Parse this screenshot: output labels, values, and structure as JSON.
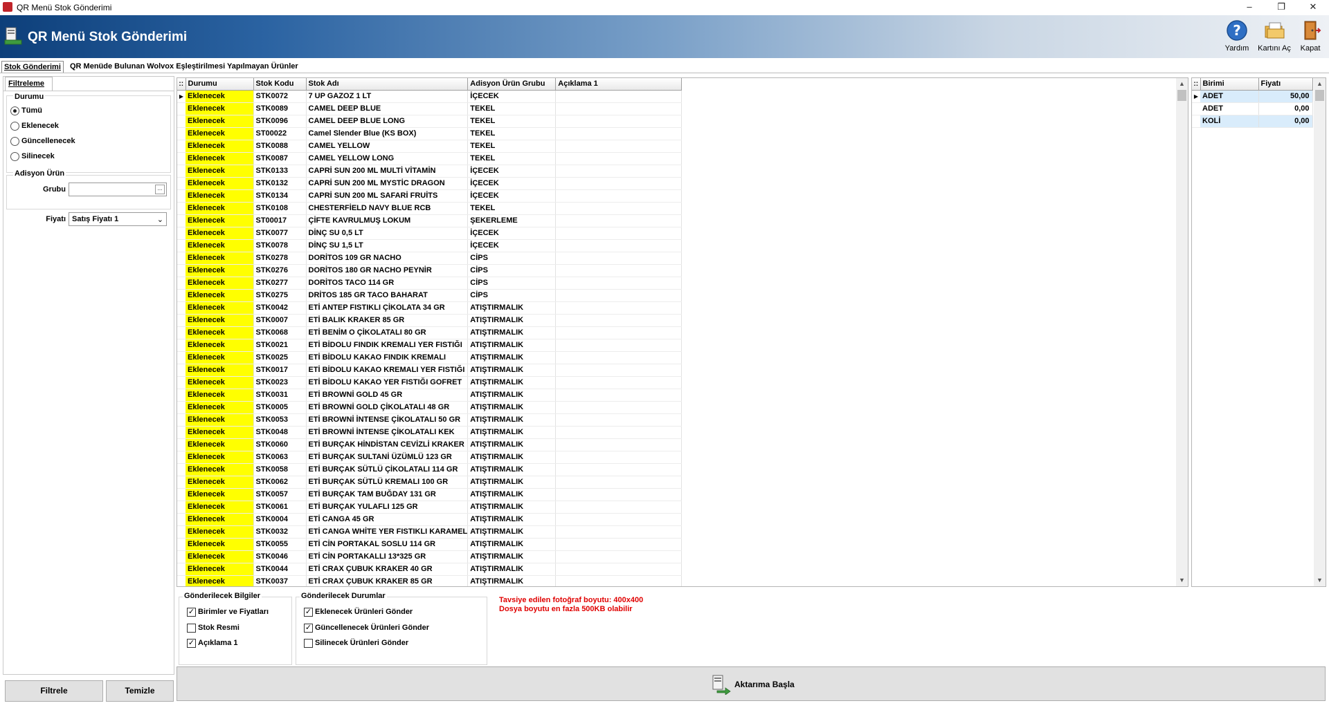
{
  "window": {
    "title": "QR Menü Stok Gönderimi",
    "controls": [
      "–",
      "❐",
      "✕"
    ]
  },
  "header": {
    "title": "QR Menü Stok Gönderimi"
  },
  "toolbar": {
    "help": "Yardım",
    "open_card": "Kartını Aç",
    "close": "Kapat"
  },
  "tabs": [
    "Stok Gönderimi",
    "QR Menüde Bulunan Wolvox Eşleştirilmesi Yapılmayan Ürünler"
  ],
  "filter": {
    "tab": "Filtreleme",
    "status_title": "Durumu",
    "status_options": [
      "Tümü",
      "Eklenecek",
      "Güncellenecek",
      "Silinecek"
    ],
    "status_selected": "Tümü",
    "group_title": "Adisyon Ürün",
    "group_label": "Grubu",
    "group_value": "",
    "price_label": "Fiyatı",
    "price_value": "Satış Fiyatı 1",
    "filter_button": "Filtrele",
    "clear_button": "Temizle"
  },
  "grid": {
    "columns": [
      "Durumu",
      "Stok Kodu",
      "Stok Adı",
      "Adisyon Ürün Grubu",
      "Açıklama 1"
    ],
    "rows": [
      [
        "Eklenecek",
        "STK0072",
        "7 UP GAZOZ 1 LT",
        "İÇECEK",
        ""
      ],
      [
        "Eklenecek",
        "STK0089",
        "CAMEL DEEP BLUE",
        "TEKEL",
        ""
      ],
      [
        "Eklenecek",
        "STK0096",
        "CAMEL DEEP BLUE LONG",
        "TEKEL",
        ""
      ],
      [
        "Eklenecek",
        "ST00022",
        "Camel Slender Blue (KS BOX)",
        "TEKEL",
        ""
      ],
      [
        "Eklenecek",
        "STK0088",
        "CAMEL YELLOW",
        "TEKEL",
        ""
      ],
      [
        "Eklenecek",
        "STK0087",
        "CAMEL YELLOW LONG",
        "TEKEL",
        ""
      ],
      [
        "Eklenecek",
        "STK0133",
        "CAPRİ SUN 200 ML MULTİ VİTAMİN",
        "İÇECEK",
        ""
      ],
      [
        "Eklenecek",
        "STK0132",
        "CAPRİ SUN 200 ML MYSTİC DRAGON",
        "İÇECEK",
        ""
      ],
      [
        "Eklenecek",
        "STK0134",
        "CAPRİ SUN 200 ML SAFARİ FRUİTS",
        "İÇECEK",
        ""
      ],
      [
        "Eklenecek",
        "STK0108",
        "CHESTERFİELD NAVY BLUE RCB",
        "TEKEL",
        ""
      ],
      [
        "Eklenecek",
        "ST00017",
        "ÇİFTE KAVRULMUŞ LOKUM",
        "ŞEKERLEME",
        ""
      ],
      [
        "Eklenecek",
        "STK0077",
        "DİNÇ SU 0,5 LT",
        "İÇECEK",
        ""
      ],
      [
        "Eklenecek",
        "STK0078",
        "DİNÇ SU 1,5 LT",
        "İÇECEK",
        ""
      ],
      [
        "Eklenecek",
        "STK0278",
        "DORİTOS 109 GR NACHO",
        "CİPS",
        ""
      ],
      [
        "Eklenecek",
        "STK0276",
        "DORİTOS 180 GR NACHO PEYNİR",
        "CİPS",
        ""
      ],
      [
        "Eklenecek",
        "STK0277",
        "DORİTOS TACO 114 GR",
        "CİPS",
        ""
      ],
      [
        "Eklenecek",
        "STK0275",
        "DRİTOS 185 GR TACO BAHARAT",
        "CİPS",
        ""
      ],
      [
        "Eklenecek",
        "STK0042",
        "ETİ ANTEP FISTIKLI ÇİKOLATA 34 GR",
        "ATIŞTIRMALIK",
        ""
      ],
      [
        "Eklenecek",
        "STK0007",
        "ETİ BALIK KRAKER 85 GR",
        "ATIŞTIRMALIK",
        ""
      ],
      [
        "Eklenecek",
        "STK0068",
        "ETİ BENİM O ÇİKOLATALI 80 GR",
        "ATIŞTIRMALIK",
        ""
      ],
      [
        "Eklenecek",
        "STK0021",
        "ETİ BİDOLU FINDIK KREMALI YER FISTIĞI",
        "ATIŞTIRMALIK",
        ""
      ],
      [
        "Eklenecek",
        "STK0025",
        "ETİ BİDOLU KAKAO FINDIK KREMALI",
        "ATIŞTIRMALIK",
        ""
      ],
      [
        "Eklenecek",
        "STK0017",
        "ETİ BİDOLU KAKAO KREMALI YER FISTIĞI",
        "ATIŞTIRMALIK",
        ""
      ],
      [
        "Eklenecek",
        "STK0023",
        "ETİ BİDOLU KAKAO YER FISTIĞI GOFRET",
        "ATIŞTIRMALIK",
        ""
      ],
      [
        "Eklenecek",
        "STK0031",
        "ETİ BROWNİ GOLD 45 GR",
        "ATIŞTIRMALIK",
        ""
      ],
      [
        "Eklenecek",
        "STK0005",
        "ETİ BROWNİ GOLD ÇİKOLATALI 48 GR",
        "ATIŞTIRMALIK",
        ""
      ],
      [
        "Eklenecek",
        "STK0053",
        "ETİ BROWNİ İNTENSE ÇİKOLATALI 50 GR",
        "ATIŞTIRMALIK",
        ""
      ],
      [
        "Eklenecek",
        "STK0048",
        "ETİ BROWNİ İNTENSE ÇİKOLATALI KEK",
        "ATIŞTIRMALIK",
        ""
      ],
      [
        "Eklenecek",
        "STK0060",
        "ETİ BURÇAK HİNDİSTAN CEVİZLİ  KRAKER",
        "ATIŞTIRMALIK",
        ""
      ],
      [
        "Eklenecek",
        "STK0063",
        "ETİ BURÇAK SULTANİ ÜZÜMLÜ 123 GR",
        "ATIŞTIRMALIK",
        ""
      ],
      [
        "Eklenecek",
        "STK0058",
        "ETİ BURÇAK SÜTLÜ  ÇİKOLATALI 114 GR",
        "ATIŞTIRMALIK",
        ""
      ],
      [
        "Eklenecek",
        "STK0062",
        "ETİ BURÇAK SÜTLÜ KREMALI 100 GR",
        "ATIŞTIRMALIK",
        ""
      ],
      [
        "Eklenecek",
        "STK0057",
        "ETİ BURÇAK TAM BUĞDAY 131 GR",
        "ATIŞTIRMALIK",
        ""
      ],
      [
        "Eklenecek",
        "STK0061",
        "ETİ BURÇAK YULAFLI 125 GR",
        "ATIŞTIRMALIK",
        ""
      ],
      [
        "Eklenecek",
        "STK0004",
        "ETİ CANGA 45 GR",
        "ATIŞTIRMALIK",
        ""
      ],
      [
        "Eklenecek",
        "STK0032",
        "ETİ CANGA WHİTE YER FISTIKLI KARAMEL",
        "ATIŞTIRMALIK",
        ""
      ],
      [
        "Eklenecek",
        "STK0055",
        "ETİ CİN PORTAKAL SOSLU 114 GR",
        "ATIŞTIRMALIK",
        ""
      ],
      [
        "Eklenecek",
        "STK0046",
        "ETİ CİN PORTAKALLI 13*325 GR",
        "ATIŞTIRMALIK",
        ""
      ],
      [
        "Eklenecek",
        "STK0044",
        "ETİ CRAX ÇUBUK KRAKER 40 GR",
        "ATIŞTIRMALIK",
        ""
      ],
      [
        "Eklenecek",
        "STK0037",
        "ETİ CRAX ÇUBUK KRAKER 85 GR",
        "ATIŞTIRMALIK",
        ""
      ]
    ]
  },
  "units": {
    "columns": [
      "Birimi",
      "Fiyatı"
    ],
    "rows": [
      [
        "ADET",
        "50,00"
      ],
      [
        "ADET",
        "0,00"
      ],
      [
        "KOLİ",
        "0,00"
      ]
    ]
  },
  "send_info": {
    "title": "Gönderilecek Bilgiler",
    "items": [
      {
        "label": "Birimler ve Fiyatları",
        "checked": true
      },
      {
        "label": "Stok Resmi",
        "checked": false
      },
      {
        "label": "Açıklama 1",
        "checked": true
      }
    ]
  },
  "send_status": {
    "title": "Gönderilecek Durumlar",
    "items": [
      {
        "label": "Eklenecek Ürünleri Gönder",
        "checked": true
      },
      {
        "label": "Güncellenecek Ürünleri Gönder",
        "checked": true
      },
      {
        "label": "Silinecek Ürünleri Gönder",
        "checked": false
      }
    ]
  },
  "warnings": [
    "Tavsiye edilen fotoğraf boyutu: 400x400",
    "Dosya boyutu en fazla 500KB olabilir"
  ],
  "start_button": "Aktarıma Başla",
  "colors": {
    "status_highlight": "#ffff00",
    "warning_text": "#e00000",
    "banner_dark": "#0d3f7a",
    "unit_highlight": "#d9ecfb"
  }
}
